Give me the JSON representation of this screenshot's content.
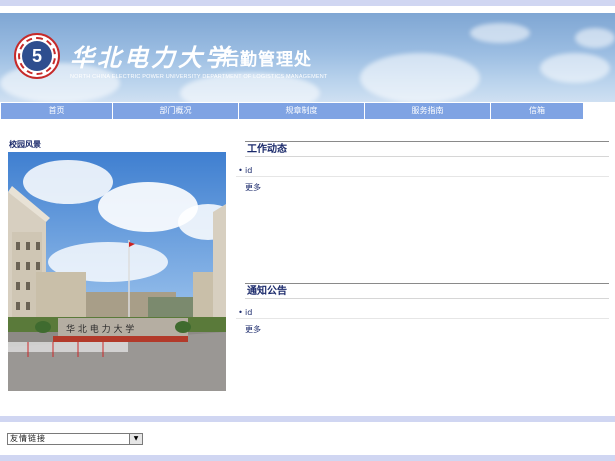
{
  "header": {
    "school_cn": "华北电力大学",
    "dept_cn": "后勤管理处",
    "school_en": "NORTH CHINA ELECTRIC POWER UNIVERSITY  DEPARTMENT OF LOGISTICS MANAGEMENT",
    "logo_glyph": "5"
  },
  "nav": {
    "items": [
      {
        "label": "首页"
      },
      {
        "label": "部门概况"
      },
      {
        "label": "规章制度"
      },
      {
        "label": "服务指南"
      },
      {
        "label": "信箱"
      }
    ]
  },
  "campus": {
    "title": "校园风景",
    "photo_sign": "华 北 电 力 大 学"
  },
  "work_news": {
    "title": "工作动态",
    "items": [
      "id"
    ],
    "more": "更多"
  },
  "notices": {
    "title": "通知公告",
    "items": [
      "id"
    ],
    "more": "更多"
  },
  "footer": {
    "links_select_value": "友情链接"
  },
  "colors": {
    "nav_bg": "#7fa3e3",
    "band": "#d0d6f2",
    "title_text": "#1b2a6b"
  }
}
